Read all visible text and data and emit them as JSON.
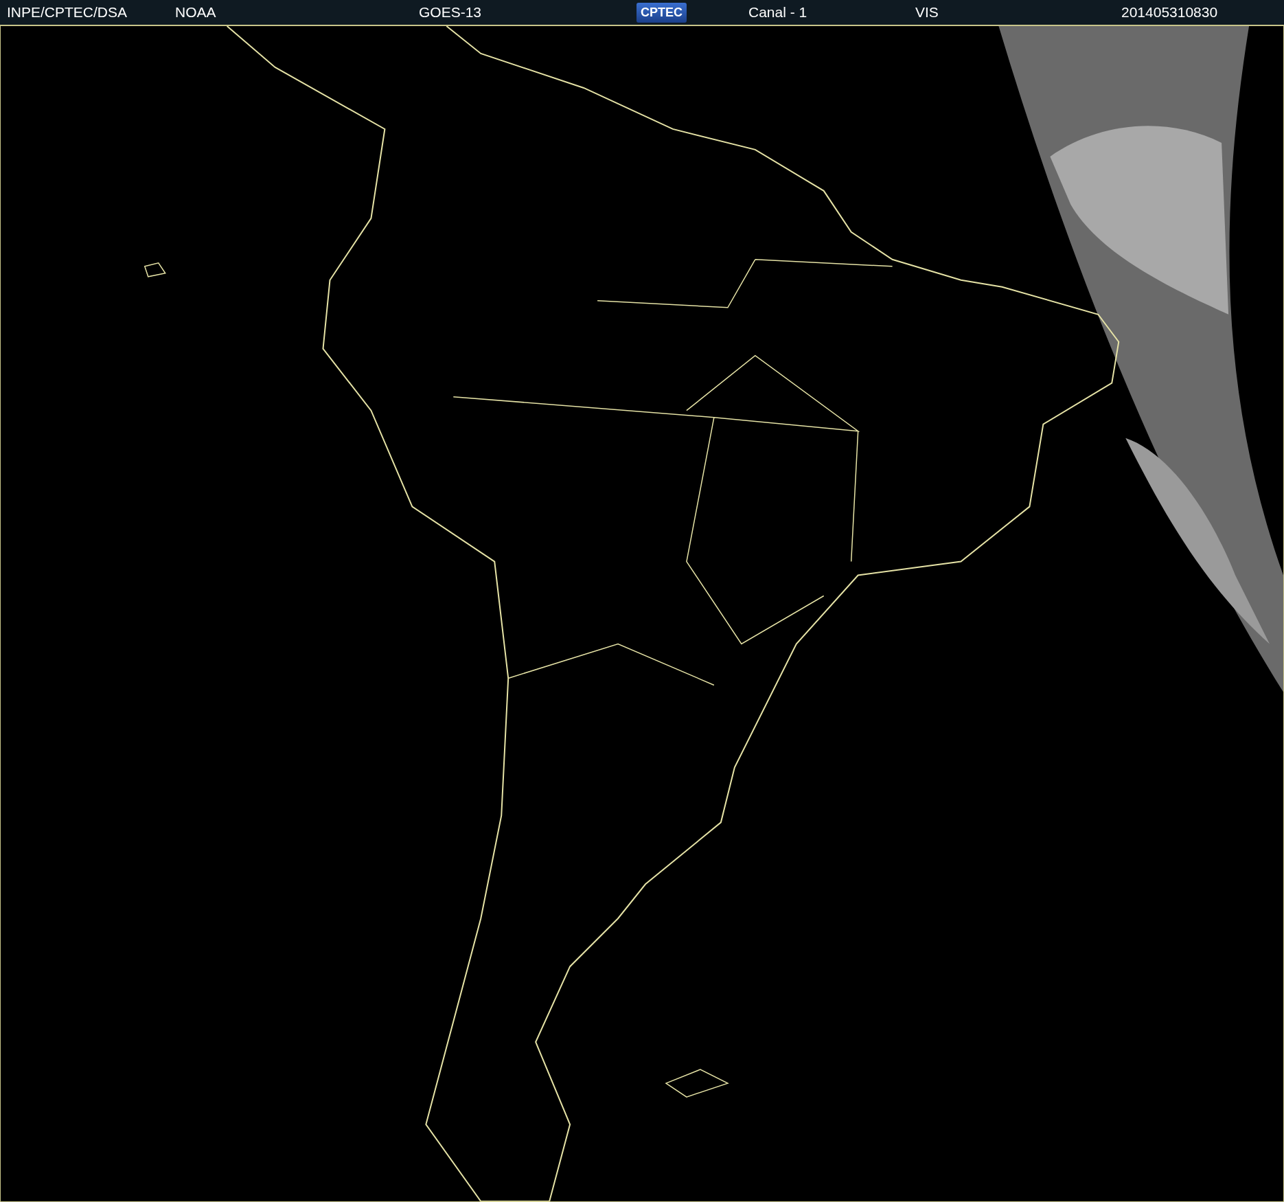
{
  "header": [
    {
      "kind": "text",
      "text": "INPE/CPTEC/DSA"
    },
    {
      "kind": "text",
      "text": "NOAA"
    },
    {
      "kind": "text",
      "text": "GOES-13"
    },
    {
      "kind": "logo",
      "text": "CPTEC"
    },
    {
      "kind": "text",
      "text": "Canal - 1"
    },
    {
      "kind": "text",
      "text": "VIS"
    },
    {
      "kind": "text",
      "text": "201405310830"
    }
  ]
}
